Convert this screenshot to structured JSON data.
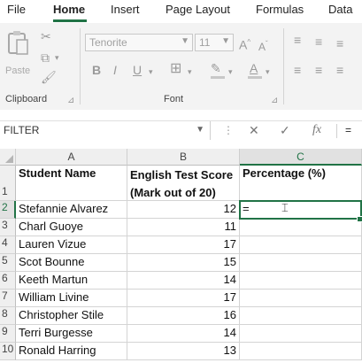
{
  "ribbon_tabs": [
    "File",
    "Home",
    "Insert",
    "Page Layout",
    "Formulas",
    "Data"
  ],
  "active_tab": "Home",
  "accent_color": "#217346",
  "ribbon": {
    "clipboard_label": "Clipboard",
    "font_label": "Font",
    "paste_label": "Paste",
    "font_name": "Tenorite",
    "font_size": "11",
    "increase_font": "A",
    "decrease_font": "A",
    "bold": "B",
    "italic": "I",
    "underline": "U",
    "font_color": "A",
    "highlight": "✎"
  },
  "formula_bar": {
    "name_box": "FILTER",
    "fx": "fx",
    "content": "="
  },
  "columns": [
    "A",
    "B",
    "C"
  ],
  "header_row": {
    "row": "1",
    "a": "Student Name",
    "b_line1": "English Test Score",
    "b_line2": "(Mark out of 20)",
    "c": "Percentage (%)"
  },
  "rows": [
    {
      "row": "2",
      "name": "Stefannie Alvarez",
      "score": "12",
      "pct": "="
    },
    {
      "row": "3",
      "name": "Charl Guoye",
      "score": "11",
      "pct": ""
    },
    {
      "row": "4",
      "name": "Lauren Vizue",
      "score": "17",
      "pct": ""
    },
    {
      "row": "5",
      "name": "Scot Bounne",
      "score": "15",
      "pct": ""
    },
    {
      "row": "6",
      "name": "Keeth Martun",
      "score": "14",
      "pct": ""
    },
    {
      "row": "7",
      "name": "William Livine",
      "score": "17",
      "pct": ""
    },
    {
      "row": "8",
      "name": "Christopher Stile",
      "score": "16",
      "pct": ""
    },
    {
      "row": "9",
      "name": "Terri Burgesse",
      "score": "14",
      "pct": ""
    },
    {
      "row": "10",
      "name": "Ronald Harring",
      "score": "13",
      "pct": ""
    }
  ]
}
